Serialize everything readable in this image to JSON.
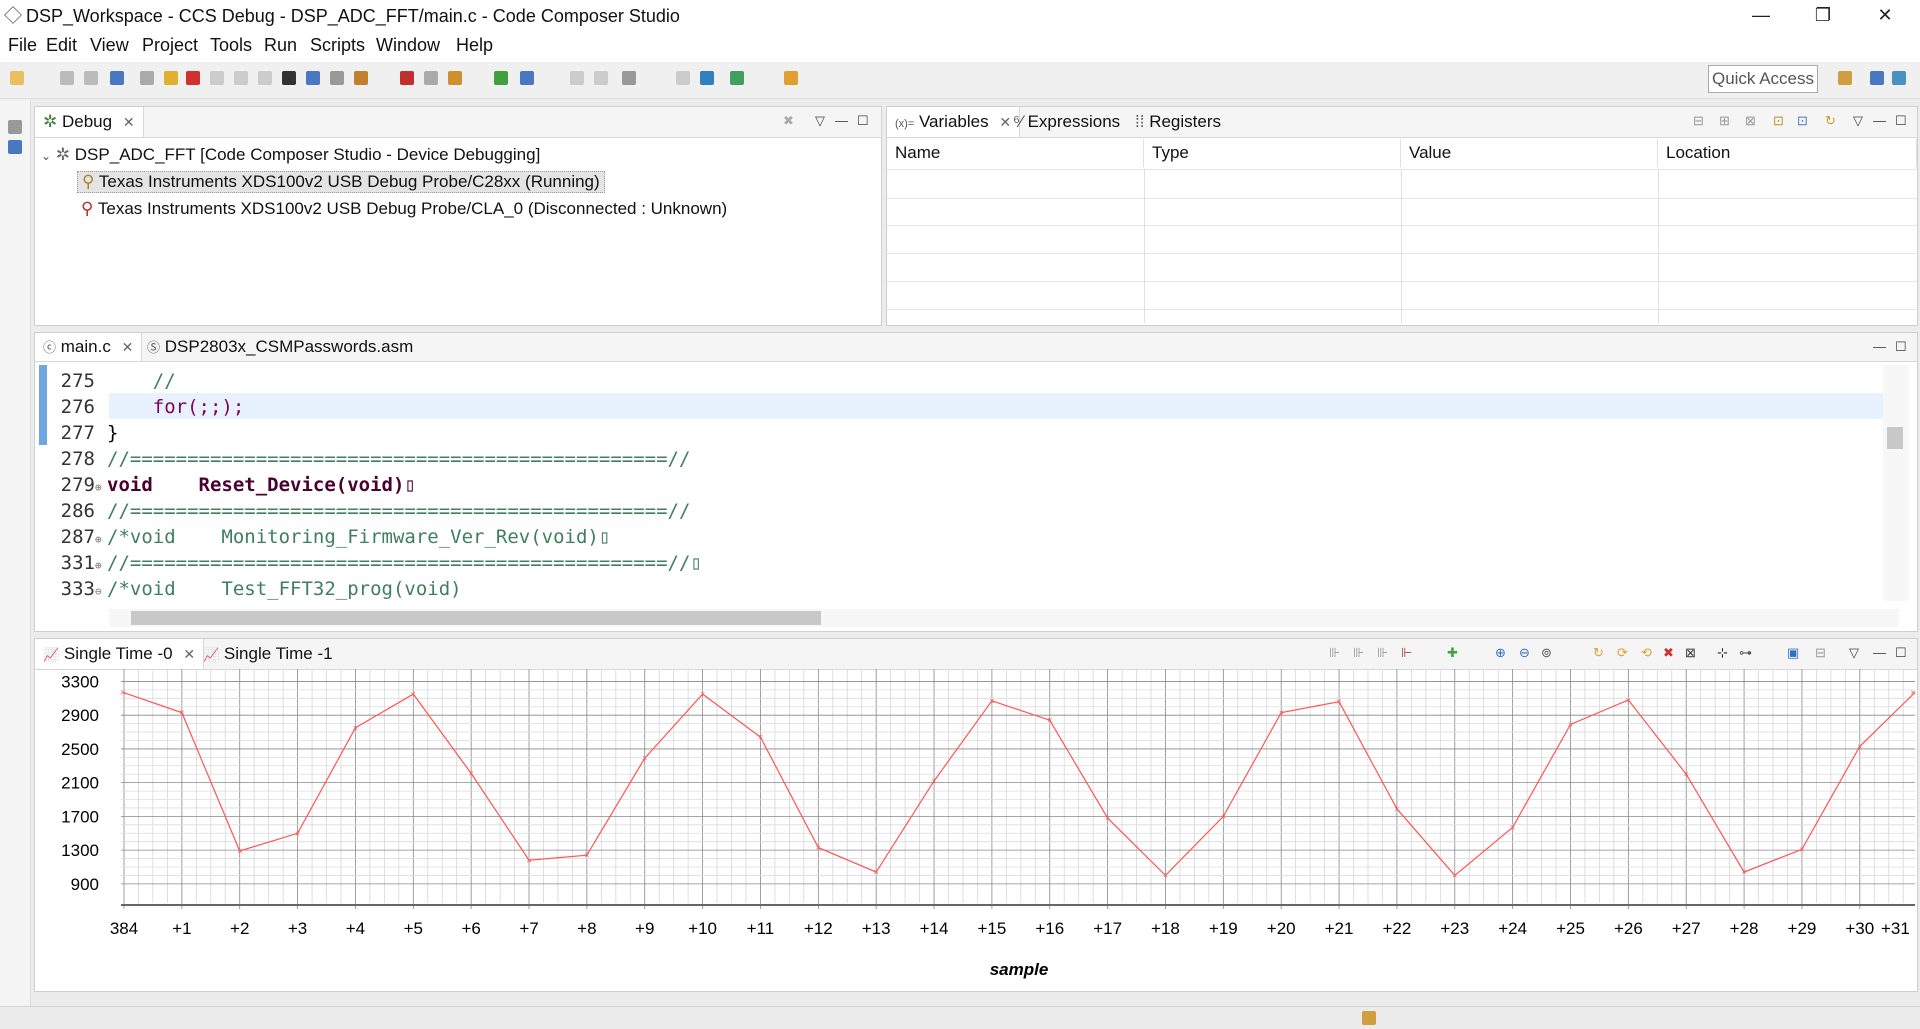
{
  "window": {
    "title": "DSP_Workspace - CCS Debug - DSP_ADC_FFT/main.c - Code Composer Studio",
    "min": "—",
    "max": "❐",
    "close": "✕"
  },
  "menu": [
    "File",
    "Edit",
    "View",
    "Project",
    "Tools",
    "Run",
    "Scripts",
    "Window",
    "Help"
  ],
  "quick_access": "Quick Access",
  "debug_view": {
    "tab": "Debug",
    "root": "DSP_ADC_FFT [Code Composer Studio - Device Debugging]",
    "items": [
      "Texas Instruments XDS100v2 USB Debug Probe/C28xx (Running)",
      "Texas Instruments XDS100v2 USB Debug Probe/CLA_0 (Disconnected : Unknown)"
    ]
  },
  "variables_view": {
    "tabs": [
      "Variables",
      "Expressions",
      "Registers"
    ],
    "columns": [
      "Name",
      "Type",
      "Value",
      "Location"
    ]
  },
  "editor": {
    "tabs": [
      "main.c",
      "DSP2803x_CSMPasswords.asm"
    ],
    "lines": [
      {
        "num": "275",
        "fold": "",
        "code": "    //"
      },
      {
        "num": "276",
        "fold": "",
        "code": "    for(;;);"
      },
      {
        "num": "277",
        "fold": "",
        "code": "}"
      },
      {
        "num": "278",
        "fold": "",
        "code": "//===============================================//"
      },
      {
        "num": "279",
        "fold": "⊕",
        "code": "void    Reset_Device(void)▯"
      },
      {
        "num": "286",
        "fold": "",
        "code": "//===============================================//"
      },
      {
        "num": "287",
        "fold": "⊕",
        "code": "/*void    Monitoring_Firmware_Ver_Rev(void)▯"
      },
      {
        "num": "331",
        "fold": "⊕",
        "code": "//===============================================//▯"
      },
      {
        "num": "333",
        "fold": "⊖",
        "code": "/*void    Test_FFT32_prog(void)"
      }
    ]
  },
  "graph_view": {
    "tabs": [
      "Single Time -0",
      "Single Time -1"
    ]
  },
  "chart_data": {
    "type": "line",
    "xlabel": "sample",
    "categories": [
      "384",
      "+1",
      "+2",
      "+3",
      "+4",
      "+5",
      "+6",
      "+7",
      "+8",
      "+9",
      "+10",
      "+11",
      "+12",
      "+13",
      "+14",
      "+15",
      "+16",
      "+17",
      "+18",
      "+19",
      "+20",
      "+21",
      "+22",
      "+23",
      "+24",
      "+25",
      "+26",
      "+27",
      "+28",
      "+29",
      "+30",
      "+31"
    ],
    "yticks": [
      "3300",
      "2900",
      "2500",
      "2100",
      "1700",
      "1300",
      "900"
    ],
    "ylim": [
      780,
      3400
    ],
    "values": [
      3170,
      2930,
      1290,
      1500,
      2750,
      3150,
      2210,
      1180,
      1240,
      2390,
      3150,
      2640,
      1330,
      1040,
      2120,
      3070,
      2840,
      1680,
      1000,
      1700,
      2930,
      3060,
      1790,
      1000,
      1570,
      2790,
      3080,
      2200,
      1040,
      1310,
      2530,
      3170
    ],
    "series_color": "#ff5555",
    "grid": true
  }
}
